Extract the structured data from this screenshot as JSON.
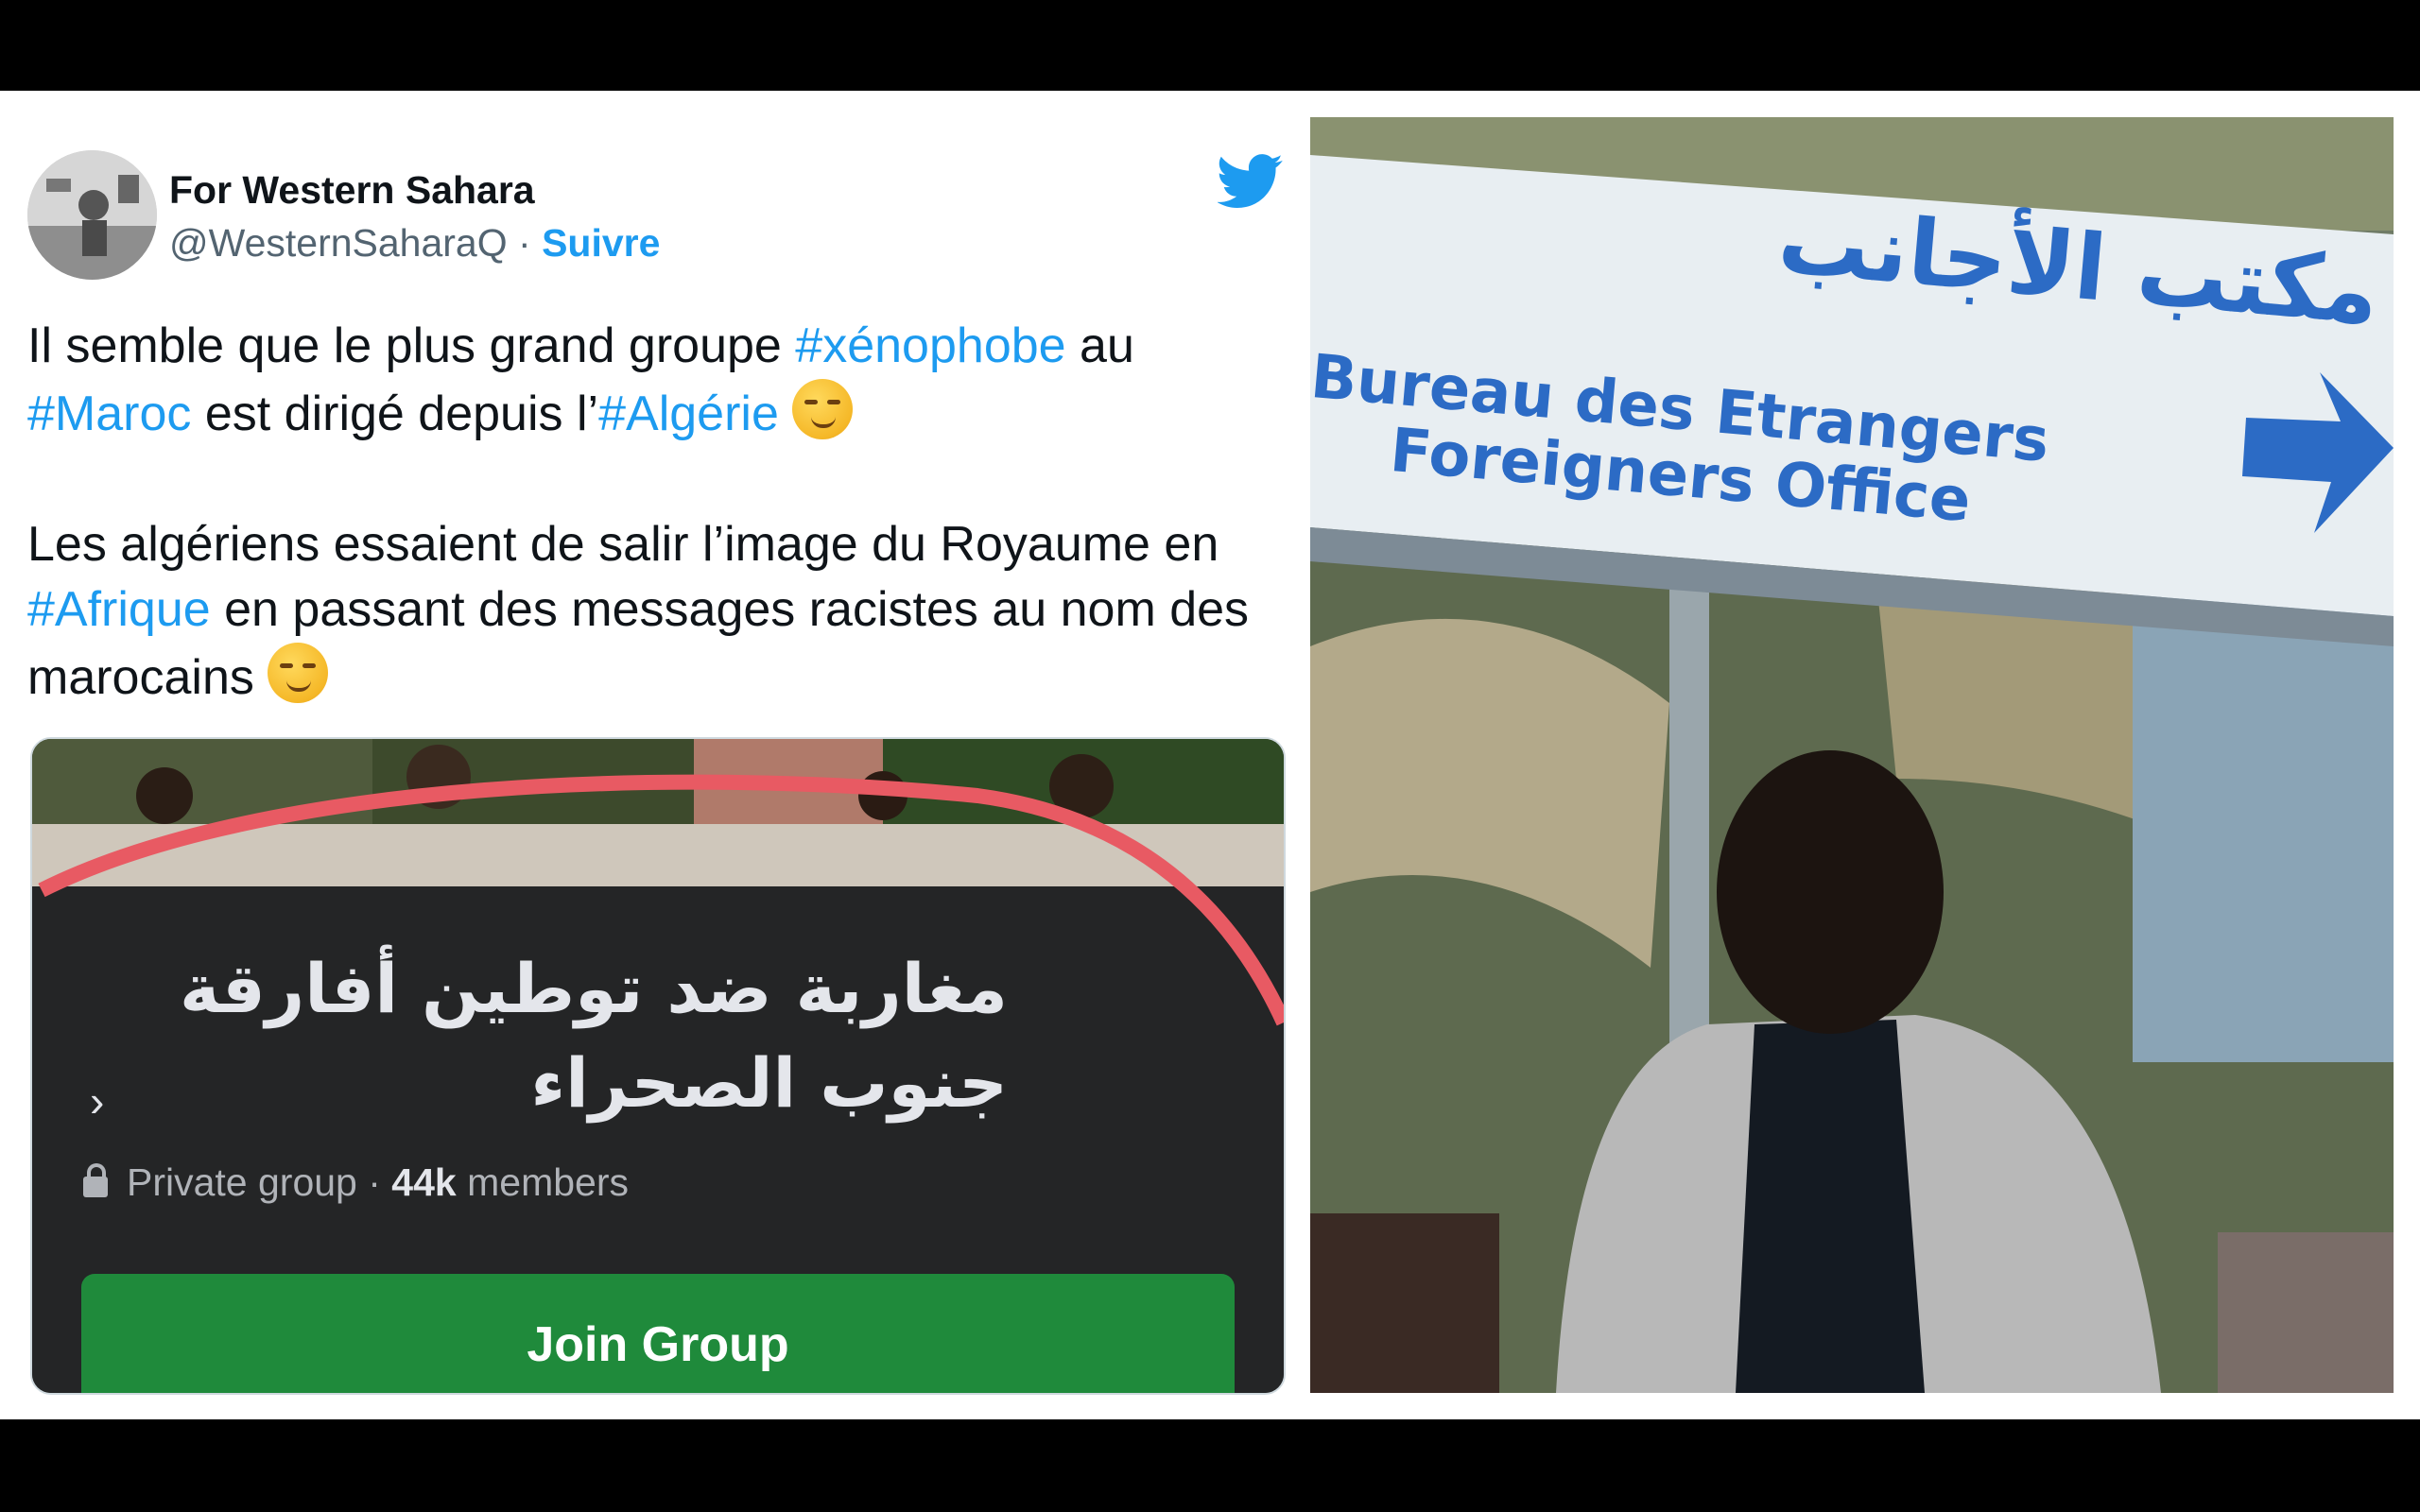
{
  "tweet": {
    "author_name": "For Western Sahara",
    "handle": "@WesternSaharaQ",
    "separator": " · ",
    "follow_label": "Suivre",
    "paragraph1": {
      "t1": "Il semble que le plus grand groupe ",
      "h1": "#xénophobe",
      "t2": " au ",
      "h2": "#Maroc",
      "t3": " est dirigé depuis l’",
      "h3": "#Algérie",
      "emoji": "smirking-face"
    },
    "paragraph2": {
      "t1": "Les algériens essaient de salir l’image du Royaume en ",
      "h1": "#Afrique",
      "t2": " en passant des messages racistes au nom des marocains ",
      "emoji": "face-with-raised-eyebrow"
    },
    "colors": {
      "hashtag": "#1d9bf0",
      "text": "#0f1419",
      "muted": "#536471"
    }
  },
  "embedded_card": {
    "group_name": "مغاربة ضد توطين أفارقة جنوب الصحراء",
    "chevron": "›",
    "privacy": "Private group",
    "meta_separator": " · ",
    "member_count": "44k",
    "members_label": "members",
    "join_label": "Join Group",
    "colors": {
      "background": "#242526",
      "join_button": "#1f8a3b",
      "highlight_arc": "#e85a63"
    }
  },
  "photo_sign": {
    "arabic": "مكتب الأجانب",
    "french": "Bureau des Etrangers",
    "english": "Foreigners Office",
    "sign_color": "#2c6bc5"
  }
}
